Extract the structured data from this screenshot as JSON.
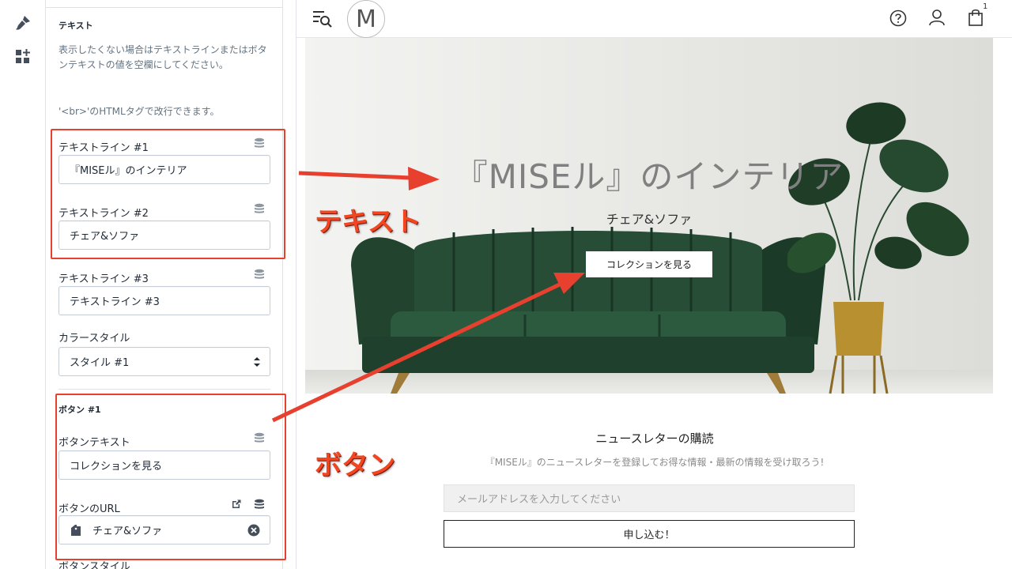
{
  "panel": {
    "section_heading": "テキスト",
    "help_text": "表示したくない場合はテキストラインまたはボタンテキストの値を空欄にしてください。",
    "br_note": "'<br>'のHTMLタグで改行できます。",
    "text_line_1": {
      "label": "テキストライン #1",
      "value": "『MISEル』のインテリア"
    },
    "text_line_2": {
      "label": "テキストライン #2",
      "value": "チェア&ソファ"
    },
    "text_line_3": {
      "label": "テキストライン #3",
      "placeholder": "テキストライン #3"
    },
    "color_style": {
      "label": "カラースタイル",
      "selected": "スタイル #1"
    },
    "button_heading": "ボタン #1",
    "button_text": {
      "label": "ボタンテキスト",
      "value": "コレクションを見る"
    },
    "button_url": {
      "label": "ボタンのURL",
      "value": "チェア&ソファ"
    },
    "button_style": {
      "label": "ボタンスタイル"
    }
  },
  "preview": {
    "logo": "M",
    "cart_count": "1",
    "hero": {
      "title": "『MISEル』のインテリア",
      "subtitle": "チェア&ソファ",
      "button": "コレクションを見る"
    },
    "newsletter": {
      "title": "ニュースレターの購読",
      "description": "『MISEル』のニュースレターを登録してお得な情報・最新の情報を受け取ろう!",
      "email_placeholder": "メールアドレスを入力してください",
      "submit": "申し込む！"
    }
  },
  "annotations": {
    "text_label": "テキスト",
    "button_label": "ボタン",
    "color": "#e8402f"
  }
}
